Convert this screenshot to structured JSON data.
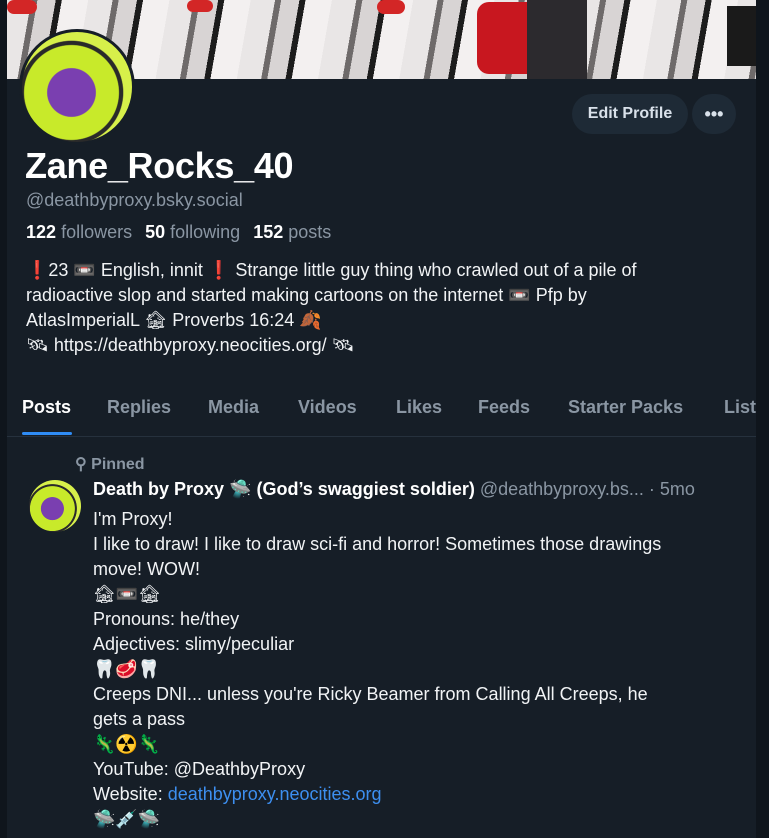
{
  "profile": {
    "edit_label": "Edit Profile",
    "more_label": "•••",
    "display_name": "Zane_Rocks_40",
    "handle": "@deathbyproxy.bsky.social",
    "followers_count": "122",
    "followers_label": "followers",
    "following_count": "50",
    "following_label": "following",
    "posts_count": "152",
    "posts_label": "posts",
    "bio_lines": [
      "❗️23 📼 English, innit ❗️ Strange little guy thing who crawled out of a pile of",
      "radioactive slop and started making cartoons on the internet 📼 Pfp by",
      "AtlasImperialL 🏚 Proverbs 16:24 🍂",
      "🛰 https://deathbyproxy.neocities.org/ 🛰"
    ]
  },
  "tabs": [
    "Posts",
    "Replies",
    "Media",
    "Videos",
    "Likes",
    "Feeds",
    "Starter Packs",
    "List"
  ],
  "post": {
    "pinned_label": "Pinned",
    "author_name": "Death by Proxy 🛸 (God’s swaggiest soldier)",
    "author_handle": "@deathbyproxy.bs...",
    "time": "· 5mo",
    "lines": [
      "I'm Proxy!",
      "I like to draw! I like to draw sci-fi and horror! Sometimes those drawings",
      "move! WOW!",
      "🏚📼🏚",
      "Pronouns: he/they",
      "Adjectives: slimy/peculiar",
      "🦷🥩🦷",
      "Creeps DNI... unless you're Ricky Beamer from Calling All Creeps, he",
      "gets a pass",
      "🦎☢️🦎",
      "YouTube: @DeathbyProxy"
    ],
    "website_label": "Website:",
    "website_link": "deathbyproxy.neocities.org",
    "last_line": "🛸💉🛸"
  }
}
